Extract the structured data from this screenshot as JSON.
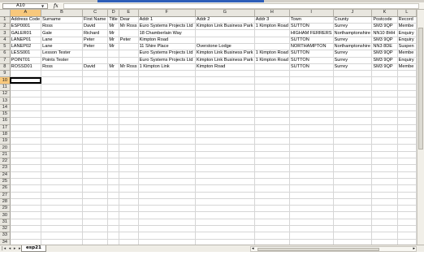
{
  "namebox": {
    "value": "A10"
  },
  "formula": {
    "fx_label": "fx",
    "value": ""
  },
  "columns": [
    "A",
    "B",
    "C",
    "D",
    "E",
    "F",
    "G",
    "H",
    "I",
    "J",
    "K",
    "L"
  ],
  "active_cell": {
    "column": "A",
    "row": "10"
  },
  "rows": [
    {
      "num": "1",
      "cells": [
        "Address Code",
        "Surname",
        "First Name",
        "Title",
        "Dear",
        "Addr 1",
        "Addr 2",
        "Addr 3",
        "Town",
        "County",
        "Postcode",
        "Record"
      ]
    },
    {
      "num": "2",
      "cells": [
        "ESP0001",
        "Ross",
        "David",
        "Mr",
        "Mr Ross",
        "Euro Systems Projects Ltd",
        "Kimpton Link Business Park",
        "1 Kimpton Road",
        "SUTTON",
        "Surrey",
        "SM3 9QP",
        "Membe"
      ]
    },
    {
      "num": "3",
      "cells": [
        "GALER01",
        "Gale",
        "Richard",
        "Mr",
        "",
        "18 Chamberlain Way",
        "",
        "",
        "HIGHAM FERRERS",
        "Northamptonshire",
        "NN10 8HH",
        "Enquiry"
      ]
    },
    {
      "num": "4",
      "cells": [
        "LANEP01",
        "Lane",
        "Peter",
        "Mr",
        "Peter",
        "Kimpton Road",
        "",
        "",
        "SUTTON",
        "Surrey",
        "SM3 9QP",
        "Enquiry"
      ]
    },
    {
      "num": "5",
      "cells": [
        "LANEP02",
        "Lane",
        "Peter",
        "Mr",
        "",
        "11 Shire Place",
        "Overstone Lodge",
        "",
        "NORTHAMPTON",
        "Northamptonshire",
        "NN3 8DE",
        "Suspen"
      ]
    },
    {
      "num": "6",
      "cells": [
        "LESS001",
        "Lesson Tester",
        "",
        "",
        "",
        "Euro Systems Projects Ltd",
        "Kimpton Link Business Park",
        "1 Kimpton Road",
        "SUTTON",
        "Surrey",
        "SM3 9QP",
        "Membe"
      ]
    },
    {
      "num": "7",
      "cells": [
        "POINT01",
        "Points Tester",
        "",
        "",
        "",
        "Euro Systems Projects Ltd",
        "Kimpton Link Business Park",
        "1 Kimpton Road",
        "SUTTON",
        "Surrey",
        "SM3 9QP",
        "Enquiry"
      ]
    },
    {
      "num": "8",
      "cells": [
        "ROSSD01",
        "Ross",
        "David",
        "Mr",
        "Mr Ross",
        "1 Kimpton Link",
        "Kimpton Road",
        "",
        "SUTTON",
        "Surrey",
        "SM3 9QP",
        "Membe"
      ]
    }
  ],
  "total_rows": 34,
  "sheet_tab": {
    "label": "esp21"
  },
  "nav_arrows": "|◂ ◂ ▸ ▸|",
  "colors": {
    "header_bg": "#e8e6df",
    "active_header": "#f8c87c",
    "grid": "#d6d6d6",
    "title_bar": "#2e5eb8"
  }
}
